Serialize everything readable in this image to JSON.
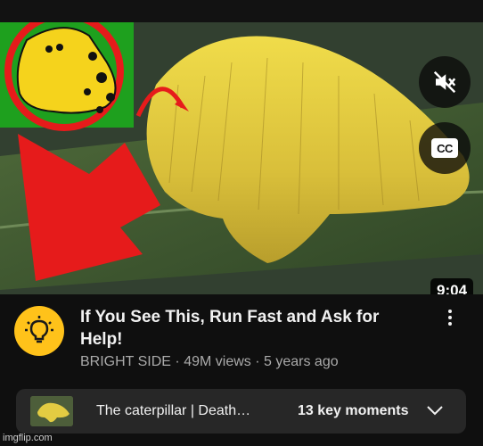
{
  "player": {
    "duration": "9:04",
    "mute_icon": "volume-off-icon",
    "cc_label": "CC"
  },
  "video": {
    "title": "If You See This, Run Fast and Ask for Help!",
    "channel": "BRIGHT SIDE",
    "separator": "·",
    "views": "49M views",
    "age": "5 years ago"
  },
  "chapters": {
    "title": "The caterpillar | Death…",
    "moments": "13 key moments"
  },
  "watermark": "imgflip.com",
  "colors": {
    "background": "#0f0f0f",
    "accent_red": "#e61b1b",
    "inset_green": "#1ea01e",
    "avatar_yellow": "#ffc21a",
    "chapter_bar": "#272727"
  }
}
